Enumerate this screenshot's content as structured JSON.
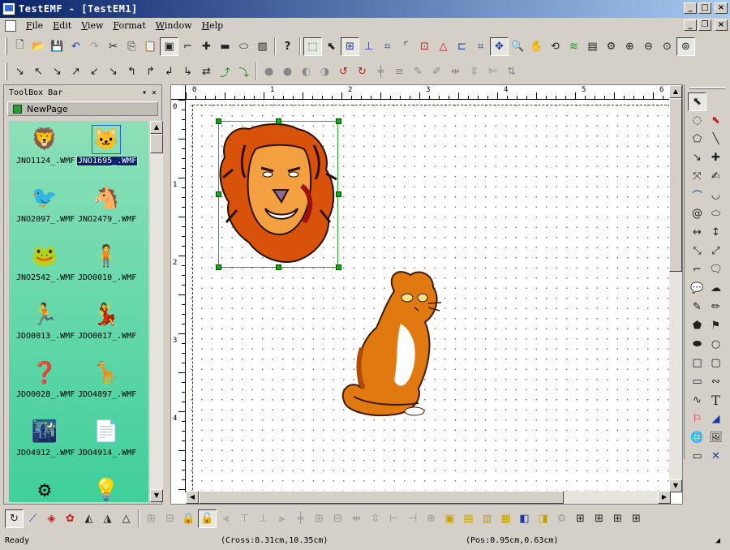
{
  "window": {
    "title": "TestEMF - [TestEM1]"
  },
  "menu": [
    {
      "label": "File"
    },
    {
      "label": "Edit"
    },
    {
      "label": "View"
    },
    {
      "label": "Format"
    },
    {
      "label": "Window"
    },
    {
      "label": "Help"
    }
  ],
  "toolbox": {
    "title": "ToolBox Bar",
    "tab": "NewPage",
    "items": [
      {
        "label": "JNO1124_.WMF",
        "icon": "lion-clipart-icon"
      },
      {
        "label": "JNO1695_.WMF",
        "icon": "cat-clipart-icon",
        "selected": true
      },
      {
        "label": "JNO2097_.WMF",
        "icon": "bird-clipart-icon"
      },
      {
        "label": "JNO2479_.WMF",
        "icon": "horse-clipart-icon"
      },
      {
        "label": "JNO2542_.WMF",
        "icon": "frog-clipart-icon"
      },
      {
        "label": "JDO0010_.WMF",
        "icon": "person-clipart-icon"
      },
      {
        "label": "JDO0013_.WMF",
        "icon": "runner-clipart-icon"
      },
      {
        "label": "JDO0017_.WMF",
        "icon": "dancer-clipart-icon"
      },
      {
        "label": "JDO0028_.WMF",
        "icon": "question-clipart-icon"
      },
      {
        "label": "JDO4897_.WMF",
        "icon": "giraffe-clipart-icon"
      },
      {
        "label": "JDO4912_.WMF",
        "icon": "night-scene-clipart-icon"
      },
      {
        "label": "JDO4914_.WMF",
        "icon": "papers-clipart-icon"
      },
      {
        "label": "",
        "icon": "machine-clipart-icon"
      },
      {
        "label": "",
        "icon": "lightbulb-clipart-icon"
      }
    ]
  },
  "rulers": {
    "horizontal": [
      "0",
      "1",
      "2",
      "3",
      "4",
      "5",
      "6"
    ],
    "vertical": [
      "0",
      "1",
      "2",
      "3",
      "4"
    ]
  },
  "status": {
    "ready": "Ready",
    "cross": "(Cross:8.31cm,10.35cm)",
    "pos": "(Pos:0.95cm,0.63cm)"
  },
  "colors": {
    "title_start": "#0a246a",
    "title_end": "#a6caf0",
    "gallery_bg": "#3fcf9a",
    "selection": "#2ca02c"
  }
}
